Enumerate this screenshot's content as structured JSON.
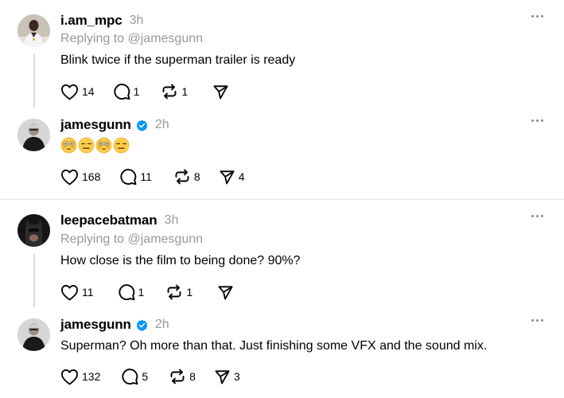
{
  "posts": [
    {
      "username": "i.am_mpc",
      "verified": false,
      "time": "3h",
      "replying_to": "Replying to @jamesgunn",
      "text": "Blink twice if the superman trailer is ready",
      "likes": "14",
      "replies": "1",
      "reposts": "1",
      "shares": ""
    },
    {
      "username": "jamesgunn",
      "verified": true,
      "time": "2h",
      "emojis": [
        "flushed-face",
        "expressionless-face",
        "flushed-face",
        "expressionless-face"
      ],
      "likes": "168",
      "replies": "11",
      "reposts": "8",
      "shares": "4"
    },
    {
      "username": "leepacebatman",
      "verified": false,
      "time": "3h",
      "replying_to": "Replying to @jamesgunn",
      "text": "How close is the film to being done? 90%?",
      "likes": "11",
      "replies": "1",
      "reposts": "1",
      "shares": ""
    },
    {
      "username": "jamesgunn",
      "verified": true,
      "time": "2h",
      "text": "Superman? Oh more than that. Just finishing some VFX and the sound mix.",
      "likes": "132",
      "replies": "5",
      "reposts": "8",
      "shares": "3"
    }
  ],
  "icons": {
    "like": "heart-icon",
    "reply": "comment-icon",
    "repost": "repost-icon",
    "share": "send-icon",
    "more": "more-icon",
    "verified": "verified-badge-icon"
  },
  "colors": {
    "verified": "#0095f6",
    "muted_text": "#999999",
    "thread_line": "#d9d9d9",
    "divider": "#e3e3e3"
  }
}
